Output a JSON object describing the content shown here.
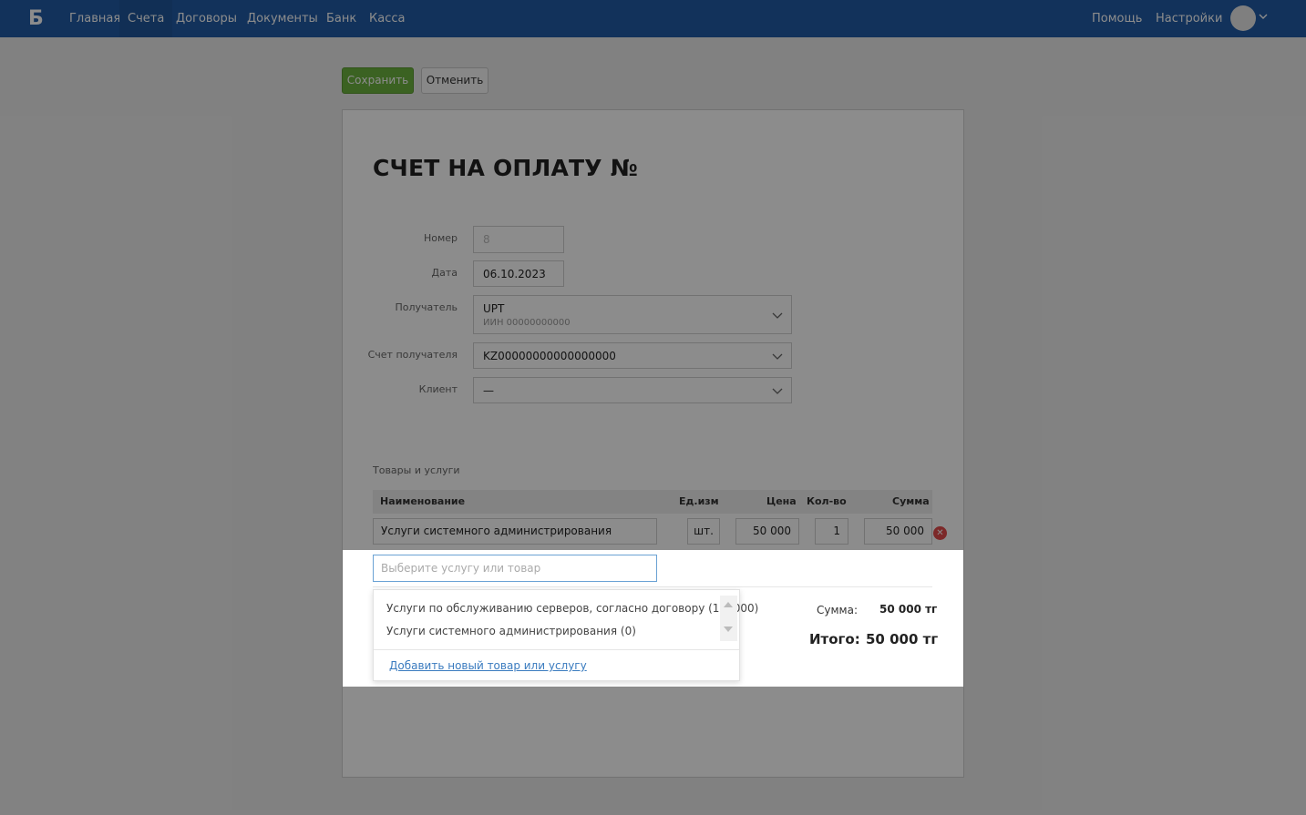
{
  "nav": {
    "logo": "Б",
    "items": [
      "Главная",
      "Счета",
      "Договоры",
      "Документы",
      "Банк",
      "Касса"
    ],
    "active": "Счета",
    "help": "Помощь",
    "settings": "Настройки"
  },
  "toolbar": {
    "save_label": "Сохранить",
    "cancel_label": "Отменить"
  },
  "document": {
    "title": "СЧЕТ НА ОПЛАТУ №",
    "fields": {
      "number_label": "Номер",
      "number_placeholder": "8",
      "date_label": "Дата",
      "date_value": "06.10.2023",
      "recipient_label": "Получатель",
      "recipient_value": "UPT",
      "recipient_sub": "ИИН 00000000000",
      "account_label": "Счет получателя",
      "account_value": "KZ00000000000000000",
      "client_label": "Клиент",
      "client_value": "—"
    },
    "goods_section_label": "Товары и услуги",
    "table": {
      "headers": {
        "name": "Наименование",
        "unit": "Ед.изм",
        "price": "Цена",
        "qty": "Кол-во",
        "sum": "Сумма"
      },
      "rows": [
        {
          "name": "Услуги системного администрирования",
          "unit": "шт.",
          "price": "50 000",
          "qty": "1",
          "sum": "50 000"
        }
      ]
    },
    "search": {
      "placeholder": "Выберите услугу или товар",
      "options": [
        "Услуги по обслуживанию серверов, согласно договору (160000)",
        "Услуги системного администрирования (0)"
      ],
      "add_link": "Добавить новый товар или услугу"
    },
    "totals": {
      "sum_label": "Сумма:",
      "sum_value": "50 000 тг",
      "total_label": "Итого:",
      "total_value": "50 000 тг"
    }
  }
}
